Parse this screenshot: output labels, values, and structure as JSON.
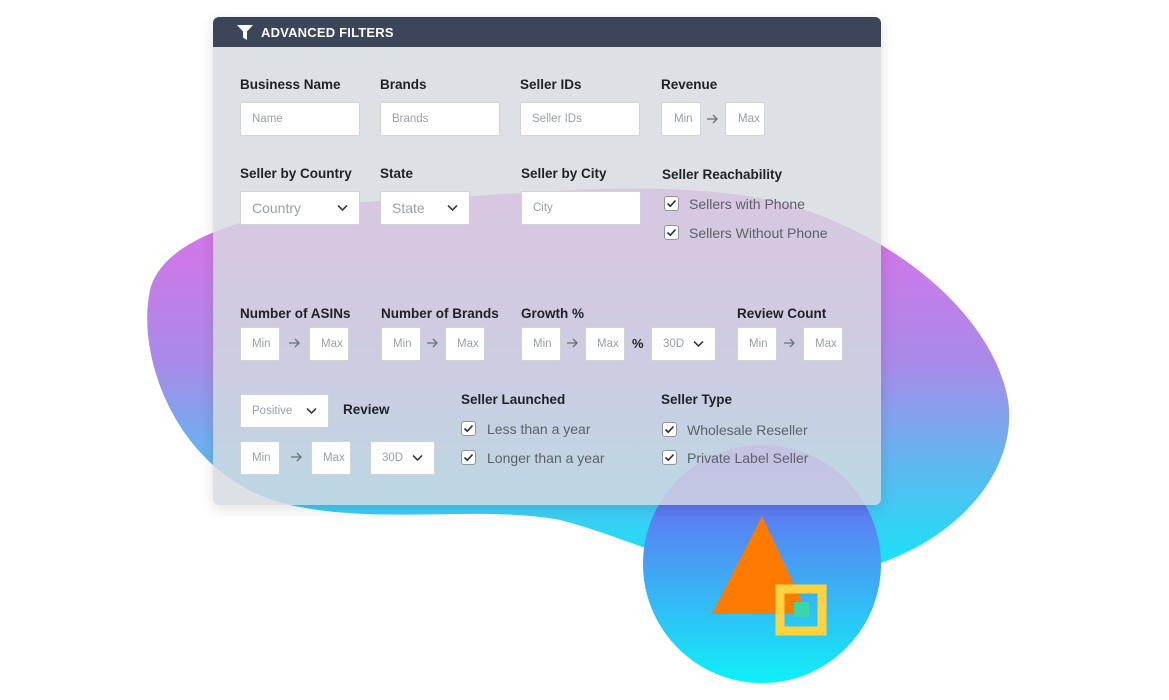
{
  "panel": {
    "title": "ADVANCED FILTERS",
    "icon": "filter-icon",
    "header_color": "#3d4559"
  },
  "fields": {
    "business_name": {
      "label": "Business Name",
      "placeholder": "Name"
    },
    "brands": {
      "label": "Brands",
      "placeholder": "Brands"
    },
    "seller_ids": {
      "label": "Seller IDs",
      "placeholder": "Seller IDs"
    },
    "revenue": {
      "label": "Revenue",
      "min": "Min",
      "max": "Max"
    },
    "seller_country": {
      "label": "Seller by Country",
      "selected": "Country"
    },
    "state": {
      "label": "State",
      "selected": "State"
    },
    "seller_city": {
      "label": "Seller by City",
      "placeholder": "City"
    },
    "num_asins": {
      "label": "Number of ASINs",
      "min": "Min",
      "max": "Max"
    },
    "num_brands": {
      "label": "Number of Brands",
      "min": "Min",
      "max": "Max"
    },
    "growth": {
      "label": "Growth %",
      "min": "Min",
      "max": "Max",
      "unit": "%",
      "period": "30D"
    },
    "review_count": {
      "label": "Review Count",
      "min": "Min",
      "max": "Max"
    },
    "review": {
      "label": "Review",
      "sentiment": "Positive",
      "min": "Min",
      "max": "Max",
      "period": "30D"
    }
  },
  "seller_reachability": {
    "label": "Seller Reachability",
    "options": [
      {
        "label": "Sellers with Phone",
        "checked": true
      },
      {
        "label": "Sellers Without Phone",
        "checked": true
      }
    ]
  },
  "seller_launched": {
    "label": "Seller Launched",
    "options": [
      {
        "label": "Less than a year",
        "checked": true
      },
      {
        "label": "Longer than a year",
        "checked": true
      }
    ]
  },
  "seller_type": {
    "label": "Seller Type",
    "options": [
      {
        "label": "Wholesale Reseller",
        "checked": true
      },
      {
        "label": "Private Label Seller",
        "checked": true
      }
    ]
  },
  "colors": {
    "blob_top": "#e36ee6",
    "blob_bottom": "#0fe8f7",
    "circle_top": "#7b4ff0",
    "circle_bottom": "#0ff0f8",
    "triangle": "#ff7a00",
    "square_outline": "#ffd23f",
    "square_inner": "#3bd6a8"
  }
}
